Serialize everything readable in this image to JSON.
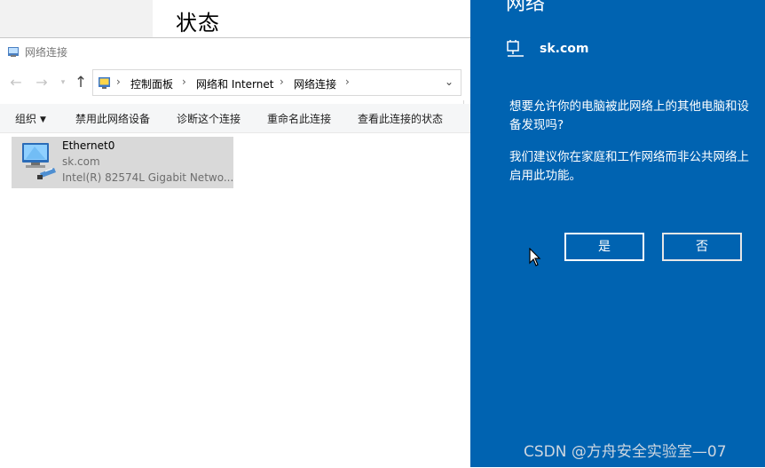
{
  "settings": {
    "title": "状态"
  },
  "explorer": {
    "window_title": "网络连接",
    "nav": {
      "back_icon": "back-arrow-icon",
      "forward_icon": "forward-arrow-icon",
      "up_icon": "up-arrow-icon"
    },
    "breadcrumb": [
      "控制面板",
      "网络和 Internet",
      "网络连接"
    ],
    "commands": [
      {
        "label": "组织",
        "has_dropdown": true
      },
      {
        "label": "禁用此网络设备"
      },
      {
        "label": "诊断这个连接"
      },
      {
        "label": "重命名此连接"
      },
      {
        "label": "查看此连接的状态"
      }
    ],
    "connection": {
      "name": "Ethernet0",
      "domain": "sk.com",
      "adapter": "Intel(R) 82574L Gigabit Netwo..."
    }
  },
  "flyout": {
    "heading": "网络",
    "network_name": "sk.com",
    "question": "想要允许你的电脑被此网络上的其他电脑和设备发现吗?",
    "recommendation": "我们建议你在家庭和工作网络而非公共网络上启用此功能。",
    "yes_label": "是",
    "no_label": "否",
    "accent_color": "#0063b1"
  },
  "watermark": "CSDN @方舟安全实验室—07"
}
